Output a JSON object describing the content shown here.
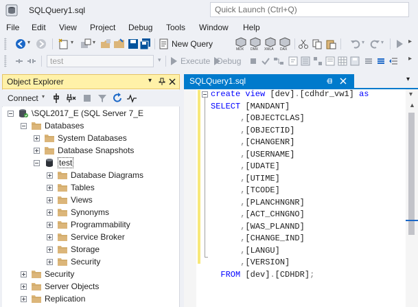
{
  "window": {
    "title": "SQLQuery1.sql",
    "quick_launch_placeholder": "Quick Launch (Ctrl+Q)"
  },
  "menu": [
    "File",
    "Edit",
    "View",
    "Project",
    "Debug",
    "Tools",
    "Window",
    "Help"
  ],
  "toolbar": {
    "new_query": "New Query",
    "execute": "Execute",
    "debug": "Debug",
    "database": "test"
  },
  "object_explorer": {
    "title": "Object Explorer",
    "connect": "Connect",
    "tree": [
      {
        "label": "\\SQL2017_E (SQL Server 7_E",
        "level": 0,
        "state": "expanded",
        "icon": "server-icon"
      },
      {
        "label": "Databases",
        "level": 1,
        "state": "expanded",
        "icon": "folder-icon"
      },
      {
        "label": "System Databases",
        "level": 2,
        "state": "collapsed",
        "icon": "folder-icon"
      },
      {
        "label": "Database Snapshots",
        "level": 2,
        "state": "collapsed",
        "icon": "folder-icon"
      },
      {
        "label": "test",
        "level": 2,
        "state": "expanded",
        "icon": "database-icon",
        "selected": true
      },
      {
        "label": "Database Diagrams",
        "level": 3,
        "state": "collapsed",
        "icon": "folder-icon"
      },
      {
        "label": "Tables",
        "level": 3,
        "state": "collapsed",
        "icon": "folder-icon"
      },
      {
        "label": "Views",
        "level": 3,
        "state": "collapsed",
        "icon": "folder-icon"
      },
      {
        "label": "Synonyms",
        "level": 3,
        "state": "collapsed",
        "icon": "folder-icon"
      },
      {
        "label": "Programmability",
        "level": 3,
        "state": "collapsed",
        "icon": "folder-icon"
      },
      {
        "label": "Service Broker",
        "level": 3,
        "state": "collapsed",
        "icon": "folder-icon"
      },
      {
        "label": "Storage",
        "level": 3,
        "state": "collapsed",
        "icon": "folder-icon"
      },
      {
        "label": "Security",
        "level": 3,
        "state": "collapsed",
        "icon": "folder-icon"
      },
      {
        "label": "Security",
        "level": 1,
        "state": "collapsed",
        "icon": "folder-icon"
      },
      {
        "label": "Server Objects",
        "level": 1,
        "state": "collapsed",
        "icon": "folder-icon"
      },
      {
        "label": "Replication",
        "level": 1,
        "state": "collapsed",
        "icon": "folder-icon"
      }
    ]
  },
  "editor": {
    "tab": "SQLQuery1.sql",
    "lines": [
      [
        {
          "t": "create view ",
          "c": "kw"
        },
        {
          "t": "[dev]",
          "c": "plain"
        },
        {
          "t": ".",
          "c": "gray"
        },
        {
          "t": "[cdhdr_vw1] ",
          "c": "plain"
        },
        {
          "t": "as",
          "c": "kw"
        }
      ],
      [
        {
          "t": "SELECT ",
          "c": "kw"
        },
        {
          "t": "[MANDANT]",
          "c": "plain"
        }
      ],
      [
        {
          "t": "      ",
          "c": "plain"
        },
        {
          "t": ",",
          "c": "gray"
        },
        {
          "t": "[OBJECTCLAS]",
          "c": "plain"
        }
      ],
      [
        {
          "t": "      ",
          "c": "plain"
        },
        {
          "t": ",",
          "c": "gray"
        },
        {
          "t": "[OBJECTID]",
          "c": "plain"
        }
      ],
      [
        {
          "t": "      ",
          "c": "plain"
        },
        {
          "t": ",",
          "c": "gray"
        },
        {
          "t": "[CHANGENR]",
          "c": "plain"
        }
      ],
      [
        {
          "t": "      ",
          "c": "plain"
        },
        {
          "t": ",",
          "c": "gray"
        },
        {
          "t": "[USERNAME]",
          "c": "plain"
        }
      ],
      [
        {
          "t": "      ",
          "c": "plain"
        },
        {
          "t": ",",
          "c": "gray"
        },
        {
          "t": "[UDATE]",
          "c": "plain"
        }
      ],
      [
        {
          "t": "      ",
          "c": "plain"
        },
        {
          "t": ",",
          "c": "gray"
        },
        {
          "t": "[UTIME]",
          "c": "plain"
        }
      ],
      [
        {
          "t": "      ",
          "c": "plain"
        },
        {
          "t": ",",
          "c": "gray"
        },
        {
          "t": "[TCODE]",
          "c": "plain"
        }
      ],
      [
        {
          "t": "      ",
          "c": "plain"
        },
        {
          "t": ",",
          "c": "gray"
        },
        {
          "t": "[PLANCHNGNR]",
          "c": "plain"
        }
      ],
      [
        {
          "t": "      ",
          "c": "plain"
        },
        {
          "t": ",",
          "c": "gray"
        },
        {
          "t": "[ACT_CHNGNO]",
          "c": "plain"
        }
      ],
      [
        {
          "t": "      ",
          "c": "plain"
        },
        {
          "t": ",",
          "c": "gray"
        },
        {
          "t": "[WAS_PLANND]",
          "c": "plain"
        }
      ],
      [
        {
          "t": "      ",
          "c": "plain"
        },
        {
          "t": ",",
          "c": "gray"
        },
        {
          "t": "[CHANGE_IND]",
          "c": "plain"
        }
      ],
      [
        {
          "t": "      ",
          "c": "plain"
        },
        {
          "t": ",",
          "c": "gray"
        },
        {
          "t": "[LANGU]",
          "c": "plain"
        }
      ],
      [
        {
          "t": "      ",
          "c": "plain"
        },
        {
          "t": ",",
          "c": "gray"
        },
        {
          "t": "[VERSION]",
          "c": "plain"
        }
      ],
      [
        {
          "t": "  FROM ",
          "c": "kw"
        },
        {
          "t": "[dev]",
          "c": "plain"
        },
        {
          "t": ".",
          "c": "gray"
        },
        {
          "t": "[CDHDR]",
          "c": "plain"
        },
        {
          "t": ";",
          "c": "gray"
        }
      ]
    ]
  },
  "colors": {
    "accent": "#007acc",
    "oe_header": "#fff1a8",
    "keyword": "#0000ff",
    "folder": "#dcb67a"
  }
}
